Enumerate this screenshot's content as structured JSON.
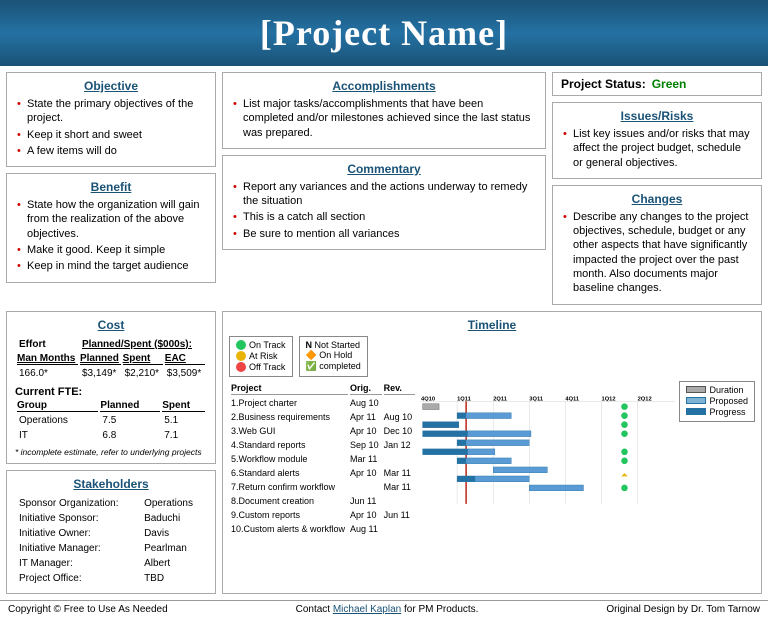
{
  "header": {
    "title": "[Project Name]"
  },
  "objective": {
    "title": "Objective",
    "items": [
      "State the primary objectives of the project.",
      "Keep it short and sweet",
      "A few items will do"
    ]
  },
  "benefit": {
    "title": "Benefit",
    "items": [
      "State how the organization will gain from the realization of the above objectives.",
      "Make it good. Keep it simple",
      "Keep in mind the target audience"
    ]
  },
  "accomplishments": {
    "title": "Accomplishments",
    "items": [
      "List major tasks/accomplishments that have been completed and/or milestones achieved since the last status was prepared."
    ]
  },
  "commentary": {
    "title": "Commentary",
    "items": [
      "Report any variances and the actions underway to remedy the situation",
      "This is a catch all section",
      "Be sure to mention all variances"
    ]
  },
  "project_status": {
    "label": "Project Status:",
    "value": "Green"
  },
  "issues_risks": {
    "title": "Issues/Risks",
    "items": [
      "List key issues and/or risks that may affect the project budget, schedule or general objectives."
    ]
  },
  "changes": {
    "title": "Changes",
    "items": [
      "Describe any changes to the project objectives, schedule, budget or any other aspects that have significantly impacted the project over the past month. Also documents major baseline changes."
    ]
  },
  "cost": {
    "title": "Cost",
    "effort_label": "Effort",
    "planned_spent_label": "Planned/Spent ($000s):",
    "columns": [
      "Man Months",
      "Planned",
      "Spent",
      "EAC"
    ],
    "rows": [
      [
        "166.0*",
        "$3,149*",
        "$2,210*",
        "$3,509*"
      ]
    ],
    "fte_title": "Current FTE:",
    "fte_columns": [
      "Group",
      "Planned",
      "Spent"
    ],
    "fte_rows": [
      [
        "Operations",
        "7.5",
        "5.1"
      ],
      [
        "IT",
        "6.8",
        "7.1"
      ]
    ],
    "note": "* incomplete estimate, refer to underlying projects"
  },
  "stakeholders": {
    "title": "Stakeholders",
    "rows": [
      [
        "Sponsor Organization:",
        "Operations"
      ],
      [
        "Initiative Sponsor:",
        "Baduchi"
      ],
      [
        "Initiative Owner:",
        "Davis"
      ],
      [
        "Initiative Manager:",
        "Pearlman"
      ],
      [
        "IT Manager:",
        "Albert"
      ],
      [
        "Project Office:",
        "TBD"
      ]
    ]
  },
  "timeline": {
    "title": "Timeline",
    "status_items": [
      {
        "dot": "green",
        "label": "On Track"
      },
      {
        "dot": "yellow",
        "label": "At Risk"
      },
      {
        "dot": "red",
        "label": "Off Track"
      }
    ],
    "status_items2": [
      {
        "dot": "none",
        "label": "N  Not Started"
      },
      {
        "dot": "none",
        "label": "On Hold"
      },
      {
        "dot": "none",
        "label": "completed"
      }
    ],
    "quarters": [
      "4Q10",
      "1Q11",
      "2Q11",
      "3Q11",
      "4Q11",
      "1Q12",
      "2Q12"
    ],
    "legend_items": [
      "Duration",
      "Proposed",
      "Progress"
    ],
    "projects": [
      {
        "num": "1",
        "name": "Project charter",
        "orig": "Aug 10",
        "rev": ""
      },
      {
        "num": "2",
        "name": "Business requirements",
        "orig": "Apr 11",
        "rev": "Aug 10"
      },
      {
        "num": "3",
        "name": "Web GUI",
        "orig": "Apr 10",
        "rev": "Dec 10"
      },
      {
        "num": "4",
        "name": "Standard reports",
        "orig": "Sep 10",
        "rev": "Jan 12"
      },
      {
        "num": "5",
        "name": "Workflow module",
        "orig": "Mar 11",
        "rev": ""
      },
      {
        "num": "6",
        "name": "Standard alerts",
        "orig": "Apr 10",
        "rev": "Mar 11"
      },
      {
        "num": "7",
        "name": "Return confirm workflow",
        "orig": "",
        "rev": "Mar 11"
      },
      {
        "num": "8",
        "name": "Document creation",
        "orig": "Jun 11",
        "rev": ""
      },
      {
        "num": "9",
        "name": "Custom reports",
        "orig": "Apr 10",
        "rev": "Jun 11"
      },
      {
        "num": "10",
        "name": "Custom alerts & workflow",
        "orig": "Aug 11",
        "rev": ""
      }
    ]
  },
  "footer": {
    "copyright": "Copyright © Free to Use As Needed",
    "contact_prefix": "Contact ",
    "contact_name": "Michael Kaplan",
    "contact_suffix": " for PM Products.",
    "credit": "Original Design by Dr. Tom Tarnow"
  }
}
